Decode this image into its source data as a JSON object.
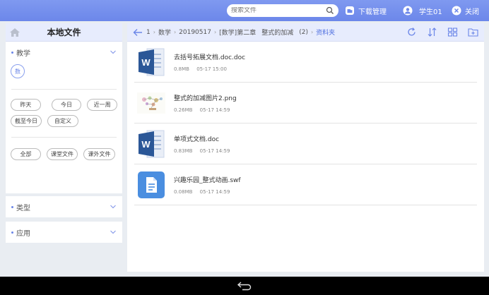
{
  "topbar": {
    "search_placeholder": "搜索文件",
    "download_label": "下载管理",
    "user_label": "学生01",
    "close_label": "关闭"
  },
  "sidebar": {
    "title": "本地文件",
    "subject_section": "教学",
    "subject_badge": "数",
    "time_filters": [
      "昨天",
      "今日",
      "近一周",
      "截至今日",
      "自定义"
    ],
    "scope_filters": [
      "全部",
      "课堂文件",
      "课外文件"
    ],
    "type_section": "类型",
    "app_section": "应用"
  },
  "breadcrumb": {
    "items": [
      "1",
      "数学",
      "20190517",
      "[数学]第二章",
      "整式的加减",
      "(2)",
      "资料夹"
    ]
  },
  "files": [
    {
      "name": "去括号拓展文档.doc.doc",
      "size": "0.8MB",
      "date": "05-17 15:00",
      "icon": "word-icon"
    },
    {
      "name": "整式的加减图片2.png",
      "size": "0.26MB",
      "date": "05-17 14:59",
      "icon": "image-icon"
    },
    {
      "name": "单项式文档.doc",
      "size": "0.83MB",
      "date": "05-17 14:59",
      "icon": "word-icon"
    },
    {
      "name": "兴趣乐园_整式动画.swf",
      "size": "0.08MB",
      "date": "05-17 14:59",
      "icon": "file-icon"
    }
  ],
  "colors": {
    "accent": "#6b86e8",
    "header_bg": "#e7ecfd",
    "word_blue": "#2b5797"
  }
}
